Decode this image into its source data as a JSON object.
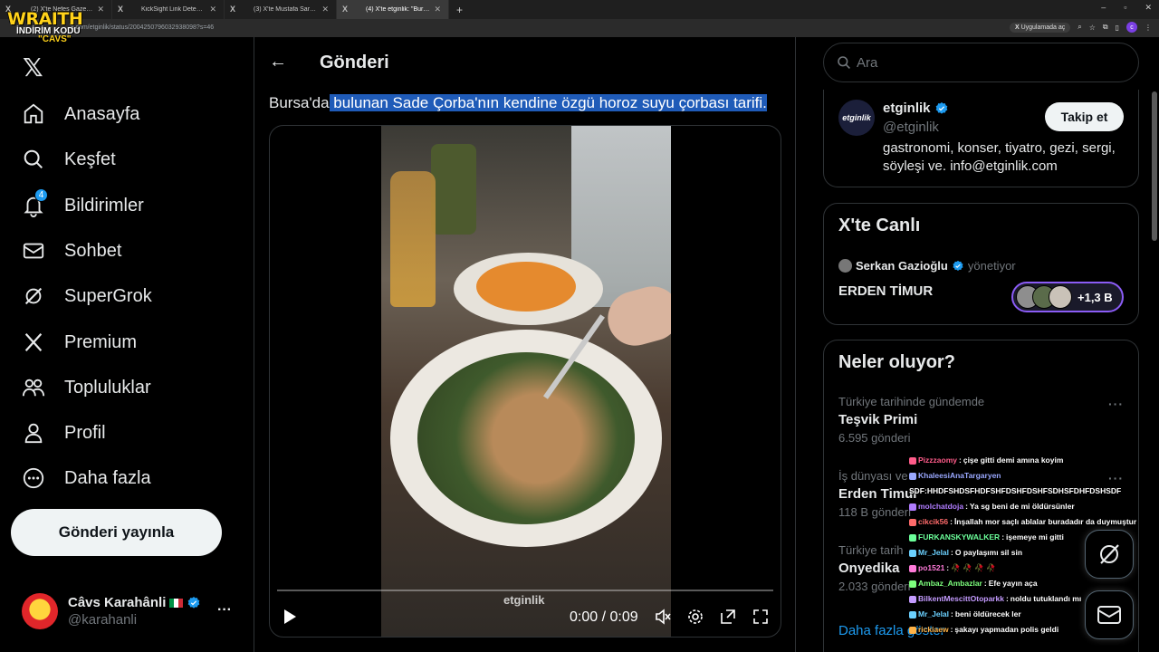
{
  "browser": {
    "tabs": [
      {
        "title": "(2) X'te Nefes Gazetesi: \"Samsu",
        "active": false
      },
      {
        "title": "KickSight Link Detector",
        "active": false
      },
      {
        "title": "(3) X'te Mustafa Sarıgül: \"Gönd",
        "active": false
      },
      {
        "title": "(4) X'te etginlik: \"Bursa'da bulun",
        "active": true
      }
    ],
    "url": "x.com/etginlik/status/2004250796032938098?s=46",
    "app_button": "Uygulamada aç",
    "profile_letter": "c"
  },
  "overlay": {
    "brand": "WRAITH",
    "line2": "İNDİRİM KODU",
    "line3": "\"CAVS\""
  },
  "nav": {
    "items": [
      {
        "label": "Anasayfa",
        "icon": "home-icon"
      },
      {
        "label": "Keşfet",
        "icon": "search-icon"
      },
      {
        "label": "Bildirimler",
        "icon": "bell-icon",
        "badge": "4"
      },
      {
        "label": "Sohbet",
        "icon": "mail-icon"
      },
      {
        "label": "SuperGrok",
        "icon": "grok-icon"
      },
      {
        "label": "Premium",
        "icon": "x-icon"
      },
      {
        "label": "Topluluklar",
        "icon": "people-icon"
      },
      {
        "label": "Profil",
        "icon": "user-icon"
      },
      {
        "label": "Daha fazla",
        "icon": "more-circle-icon"
      }
    ],
    "post_button": "Gönderi yayınla",
    "account": {
      "name": "Câvs Karahânli",
      "handle": "@karahanli"
    }
  },
  "main": {
    "title": "Gönderi",
    "post_text_plain": "Bursa'da",
    "post_text_selected": " bulunan Sade Çorba'nın kendine özgü horoz suyu çorbası tarifi.",
    "video": {
      "watermark": "etginlik",
      "time": "0:00 / 0:09",
      "progress": 0.0
    }
  },
  "right": {
    "search_placeholder": "Ara",
    "profile": {
      "avatar_text": "etginlik",
      "name": "etginlik",
      "handle": "@etginlik",
      "bio": "gastronomi, konser, tiyatro, gezi, sergi, söyleşi ve. info@etginlik.com",
      "follow_label": "Takip et"
    },
    "live": {
      "heading": "X'te Canlı",
      "host": "Serkan Gazioğlu",
      "host_role": "yönetiyor",
      "title": "ERDEN TİMUR",
      "listeners": "+1,3 B"
    },
    "trends": {
      "heading": "Neler oluyor?",
      "items": [
        {
          "context": "Türkiye tarihinde gündemde",
          "name": "Teşvik Primi",
          "count": "6.595 gönderi"
        },
        {
          "context": "İş dünyası ve",
          "name": "Erden Timur",
          "count": "118 B gönderi"
        },
        {
          "context": "Türkiye tarih",
          "name": "Onyedika",
          "count": "2.033 gönderi"
        }
      ],
      "show_more": "Daha fazla göster"
    }
  },
  "chat": [
    {
      "user": "Pizzzaomy",
      "color": "#ff5c8a",
      "msg": "çişe gitti demi amına koyim"
    },
    {
      "user": "KhaleesiAnaTargaryen",
      "color": "#9aa8ff",
      "msg": ""
    },
    {
      "user": "",
      "color": "#ffffff",
      "msg": "SDF:HHDFSHDSFHDFSHFDSHFDSHFSDHSFDHFDSHSDF"
    },
    {
      "user": "molchatdoja",
      "color": "#b07cff",
      "msg": "Ya sg beni de mi öldürsünler"
    },
    {
      "user": "cikcik56",
      "color": "#ff6b6b",
      "msg": "İnşallah mor saçlı ablalar buradadır da duymuştur"
    },
    {
      "user": "FURKANSKYWALKER",
      "color": "#6bff9a",
      "msg": "işemeye mi gitti"
    },
    {
      "user": "Mr_Jelal",
      "color": "#6bd1ff",
      "msg": "O paylaşımı sil sin"
    },
    {
      "user": "po1521",
      "color": "#ff7ad9",
      "msg": "🥀 🥀 🥀 🥀"
    },
    {
      "user": "Ambaz_Ambazlar",
      "color": "#7dff7d",
      "msg": "Efe yayın aça"
    },
    {
      "user": "BilkentMescittOtoparkk",
      "color": "#c49bff",
      "msg": "noldu tutuklandı mı"
    },
    {
      "user": "Mr_Jelal",
      "color": "#6bd1ff",
      "msg": "beni öldürecek ler"
    },
    {
      "user": "rickiaew",
      "color": "#ffb347",
      "msg": "şakayı yapmadan polis geldi"
    }
  ],
  "colors": {
    "accent": "#1d9bf0",
    "selection": "#1f5bb8",
    "live_border": "#8b5cf6",
    "overlay_yellow": "#ffd21a"
  }
}
